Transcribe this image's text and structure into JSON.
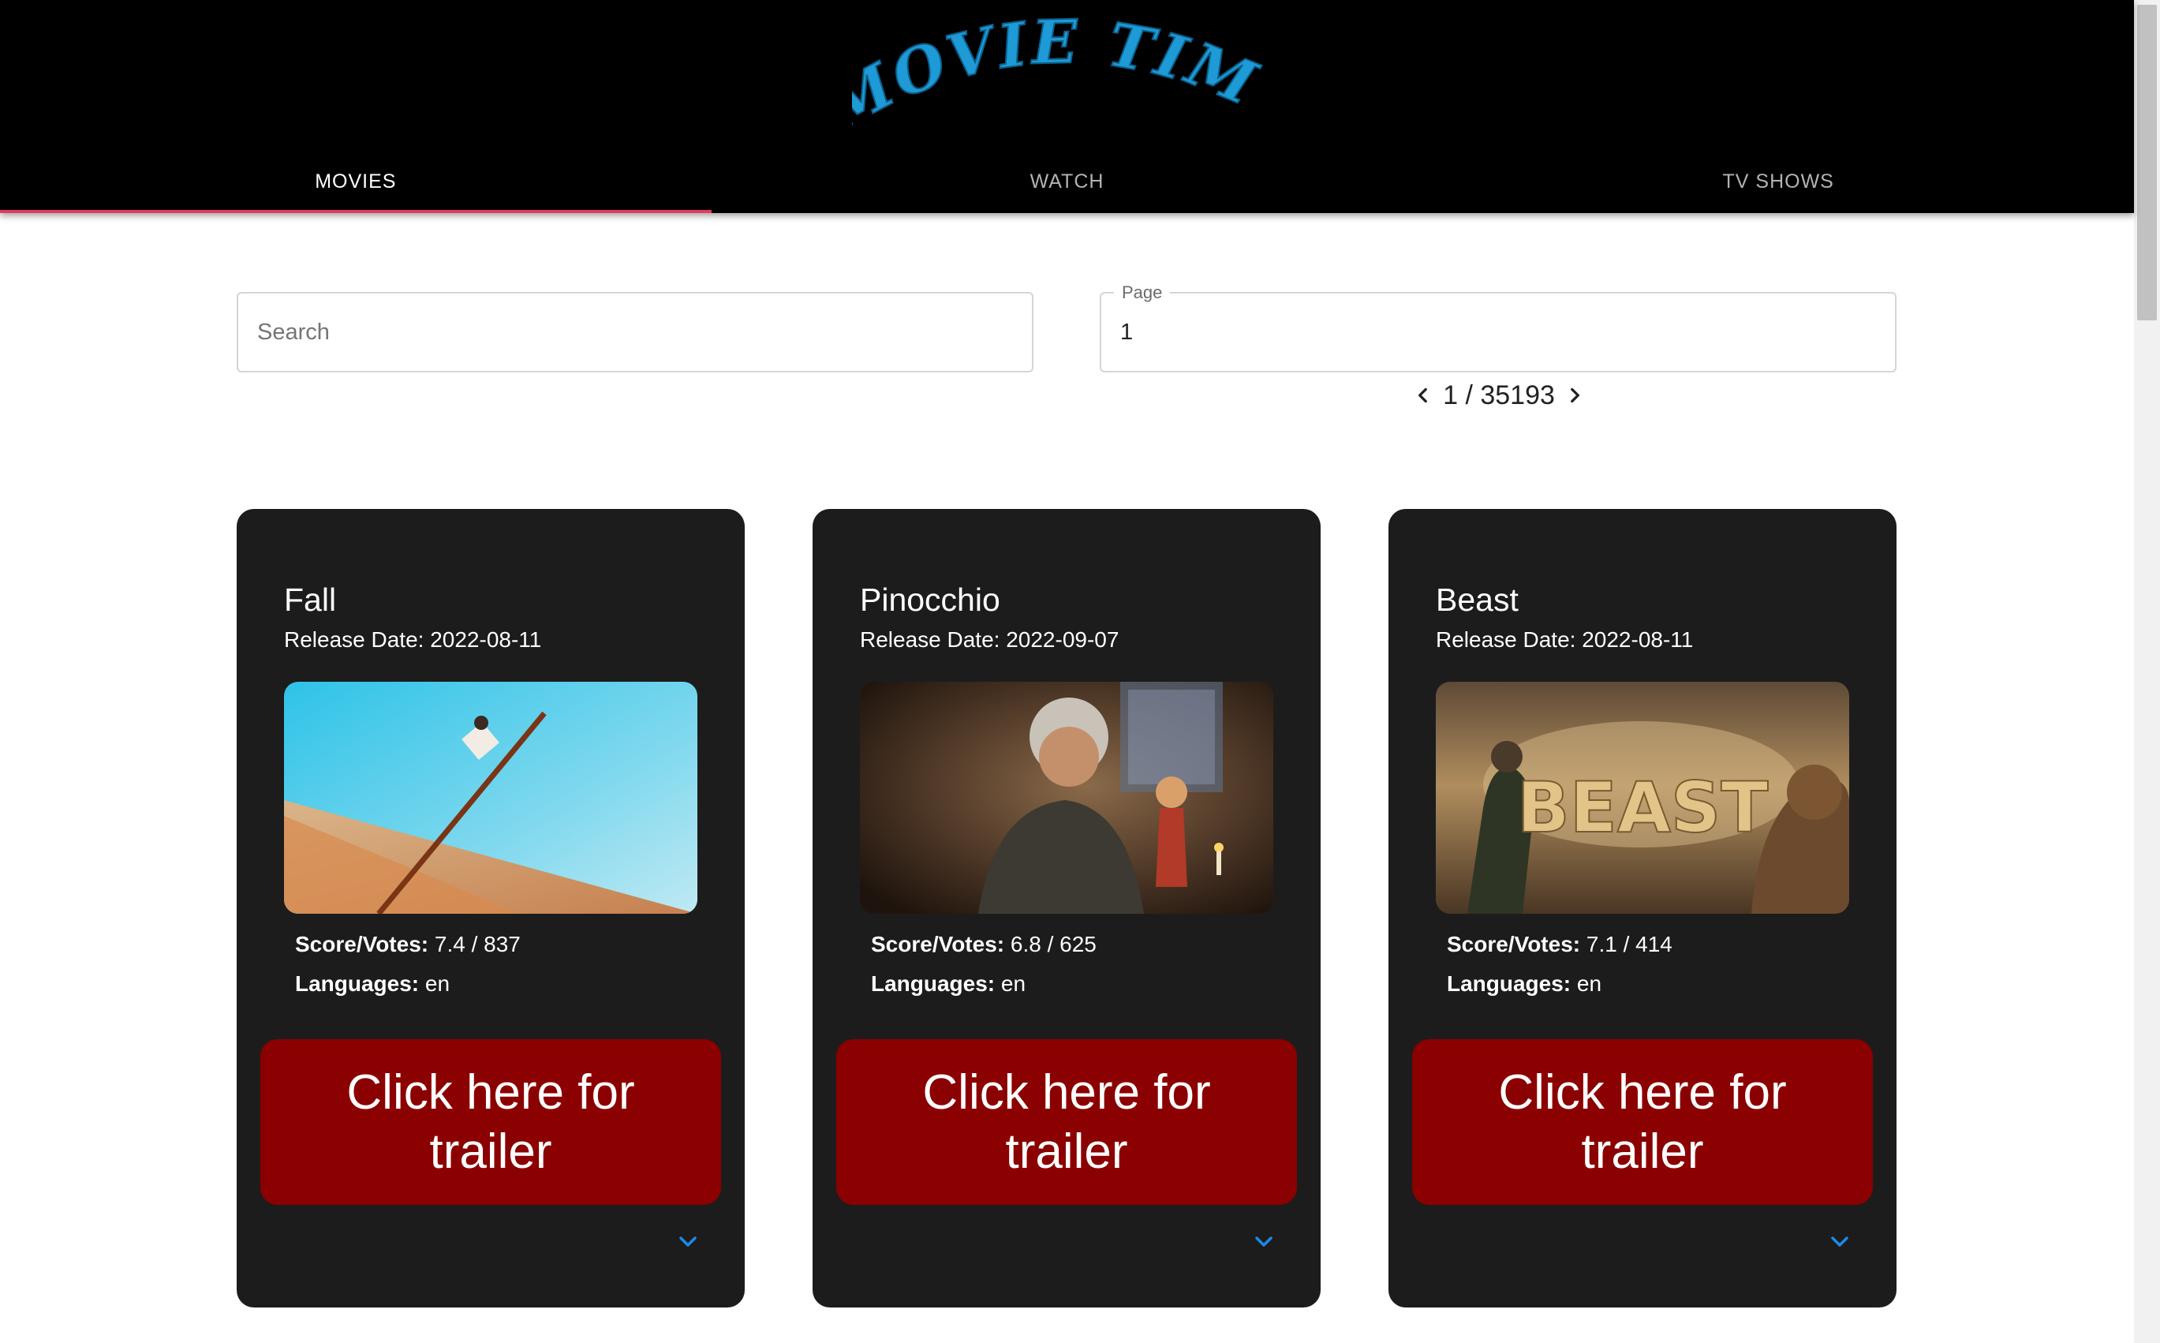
{
  "app": {
    "logo_text": "MOVIE TIME"
  },
  "nav": {
    "tabs": [
      {
        "label": "MOVIES",
        "active": true
      },
      {
        "label": "WATCH",
        "active": false
      },
      {
        "label": "TV SHOWS",
        "active": false
      }
    ]
  },
  "search": {
    "placeholder": "Search",
    "value": ""
  },
  "page_field": {
    "label": "Page",
    "value": "1"
  },
  "pager": {
    "text": "1 / 35193",
    "prev_icon": "chevron-left-icon",
    "next_icon": "chevron-right-icon"
  },
  "colors": {
    "header_bg": "#000000",
    "accent_underline": "#e33a5c",
    "card_bg": "#1c1c1c",
    "trailer_button": "#8b0000",
    "logo_blue": "#1e9ad6",
    "expand_icon": "#1e88e5"
  },
  "cards": [
    {
      "title": "Fall",
      "release": "Release Date: 2022-08-11",
      "score_label": "Score/Votes:",
      "score_value": "7.4 / 837",
      "lang_label": "Languages:",
      "lang_value": "en",
      "button": "Click here for trailer",
      "image_icon": "poster-fall-image",
      "expand_icon": "chevron-down-icon"
    },
    {
      "title": "Pinocchio",
      "release": "Release Date: 2022-09-07",
      "score_label": "Score/Votes:",
      "score_value": "6.8 / 625",
      "lang_label": "Languages:",
      "lang_value": "en",
      "button": "Click here for trailer",
      "image_icon": "poster-pinocchio-image",
      "expand_icon": "chevron-down-icon"
    },
    {
      "title": "Beast",
      "release": "Release Date: 2022-08-11",
      "score_label": "Score/Votes:",
      "score_value": "7.1 / 414",
      "lang_label": "Languages:",
      "lang_value": "en",
      "button": "Click here for trailer",
      "image_icon": "poster-beast-image",
      "image_text": "BEAST",
      "expand_icon": "chevron-down-icon"
    }
  ]
}
